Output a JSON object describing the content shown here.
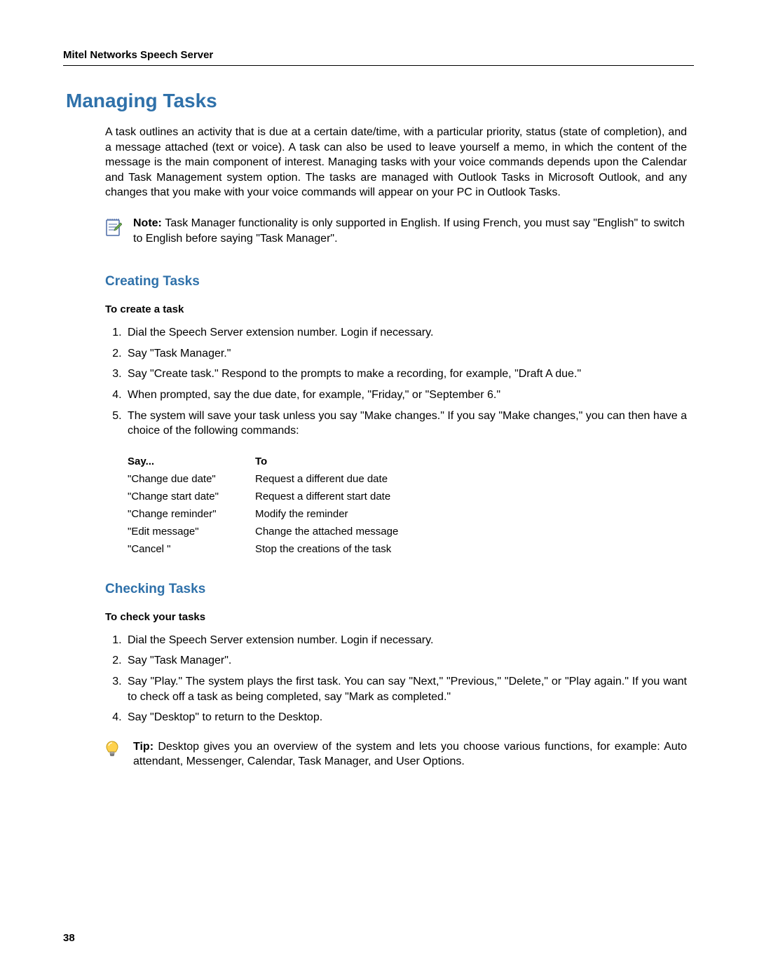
{
  "runningHead": "Mitel Networks Speech Server",
  "pageNumber": "38",
  "h1": "Managing Tasks",
  "intro": "A task outlines an activity that is due at a certain date/time, with a particular priority, status (state of completion), and a message attached (text or voice). A task can also be used to leave yourself a memo, in which the content of the message is the main component of interest. Managing tasks with your voice commands depends upon the Calendar and Task Management system option. The tasks are managed with Outlook Tasks in Microsoft Outlook, and any changes that you make with your voice commands will appear on your PC in Outlook Tasks.",
  "note": {
    "label": "Note: ",
    "text": "Task Manager functionality is only supported in English. If using French, you must say \"English\" to switch to English before saying \"Task Manager\"."
  },
  "section1": {
    "title": "Creating Tasks",
    "instrHead": "To create a task",
    "steps": [
      "Dial the Speech Server extension number. Login if necessary.",
      "Say \"Task Manager.\"",
      "Say \"Create task.\" Respond to the prompts to make a recording, for example, \"Draft A due.\"",
      "When prompted, say the due date, for example, \"Friday,\" or \"September 6.\"",
      "The system will save your task unless you say \"Make changes.\" If you say \"Make changes,\" you can then have a choice of the following commands:"
    ],
    "table": {
      "headers": [
        "Say...",
        "To"
      ],
      "rows": [
        [
          "\"Change due date\"",
          "Request a different due date"
        ],
        [
          "\"Change start date\"",
          "Request a different start date"
        ],
        [
          "\"Change reminder\"",
          "Modify the reminder"
        ],
        [
          "\"Edit message\"",
          "Change the attached message"
        ],
        [
          "\"Cancel \"",
          "Stop the creations of the task"
        ]
      ]
    }
  },
  "section2": {
    "title": "Checking Tasks",
    "instrHead": "To check your tasks",
    "steps": [
      "Dial the Speech Server extension number. Login if necessary.",
      "Say \"Task Manager\".",
      "Say \"Play.\" The system plays the first task. You can say \"Next,\" \"Previous,\" \"Delete,\" or \"Play again.\" If you want to check off a task as being completed, say \"Mark as completed.\"",
      "Say \"Desktop\" to return to the Desktop."
    ]
  },
  "tip": {
    "label": "Tip: ",
    "text": "Desktop gives you an overview of the system and lets you choose various functions, for example: Auto attendant, Messenger, Calendar, Task Manager, and User Options."
  }
}
